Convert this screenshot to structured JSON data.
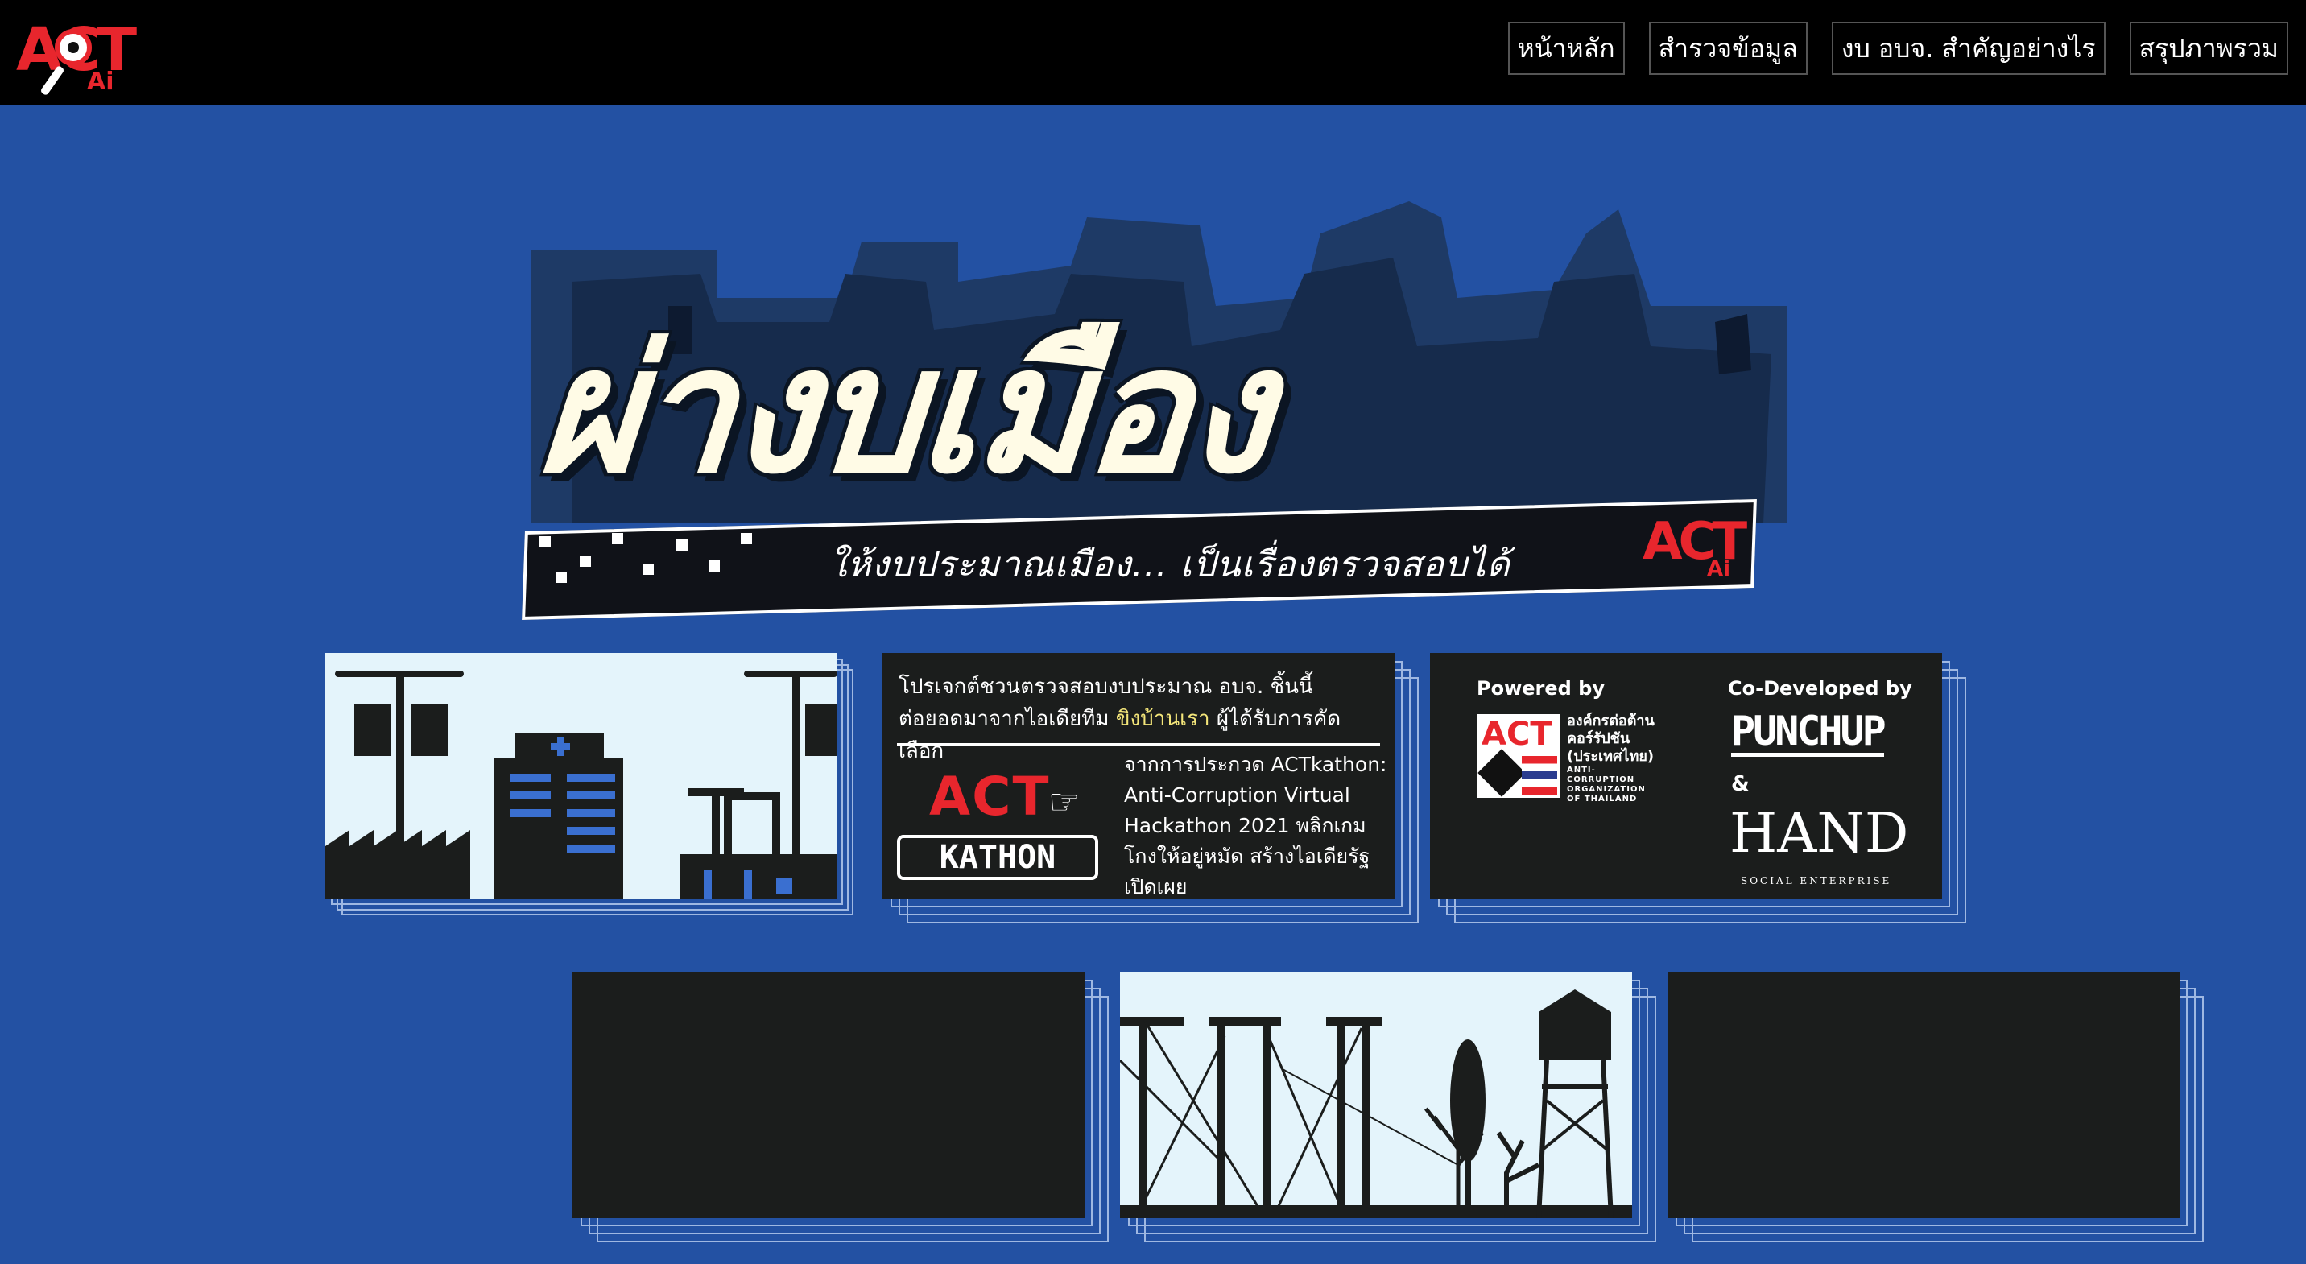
{
  "header": {
    "logo_text": "ACT",
    "logo_sub": "Ai",
    "nav": [
      "หน้าหลัก",
      "สำรวจข้อมูล",
      "งบ อบจ. สำคัญอย่างไร",
      "สรุปภาพรวม"
    ]
  },
  "hero": {
    "title": "ผ่างบเมือง",
    "tagline": "ให้งบประมาณเมือง... เป็นเรื่องตรวจสอบได้",
    "logo_text": "ACT",
    "logo_sub": "Ai"
  },
  "intro_card": {
    "line1": "โปรเจกต์ชวนตรวจสอบงบประมาณ อบจ. ชิ้นนี้",
    "line2_pre": "ต่อยอดมาจากไอเดียทีม",
    "line2_highlight": "ขิงบ้านเรา",
    "line2_post": "ผู้ได้รับการคัดเลือก",
    "act_label": "ACT",
    "kathon_label": "KATHON",
    "contest": "จากการประกวด ACTkathon: Anti-Corruption Virtual Hackathon 2021 พลิกเกม โกงให้อยู่หมัด สร้างไอเดียรัฐเปิดเผย"
  },
  "credits_card": {
    "powered_by": "Powered by",
    "co_developed_by": "Co-Developed by",
    "org_logo_text": "ACT",
    "org_name_th": "องค์กรต่อต้าน คอร์รัปชัน (ประเทศไทย)",
    "org_name_en": "ANTI-CORRUPTION ORGANIZATION OF THAILAND",
    "punchup": "PUNCHUP",
    "ampersand": "&",
    "hand": "HAND",
    "hand_sub": "SOCIAL ENTERPRISE"
  },
  "colors": {
    "background": "#2351a3",
    "topbar": "#000000",
    "card_dark": "#1b1d1c",
    "card_light": "#e4f4fb",
    "accent_red": "#e8262d",
    "highlight": "#f4e67a"
  }
}
